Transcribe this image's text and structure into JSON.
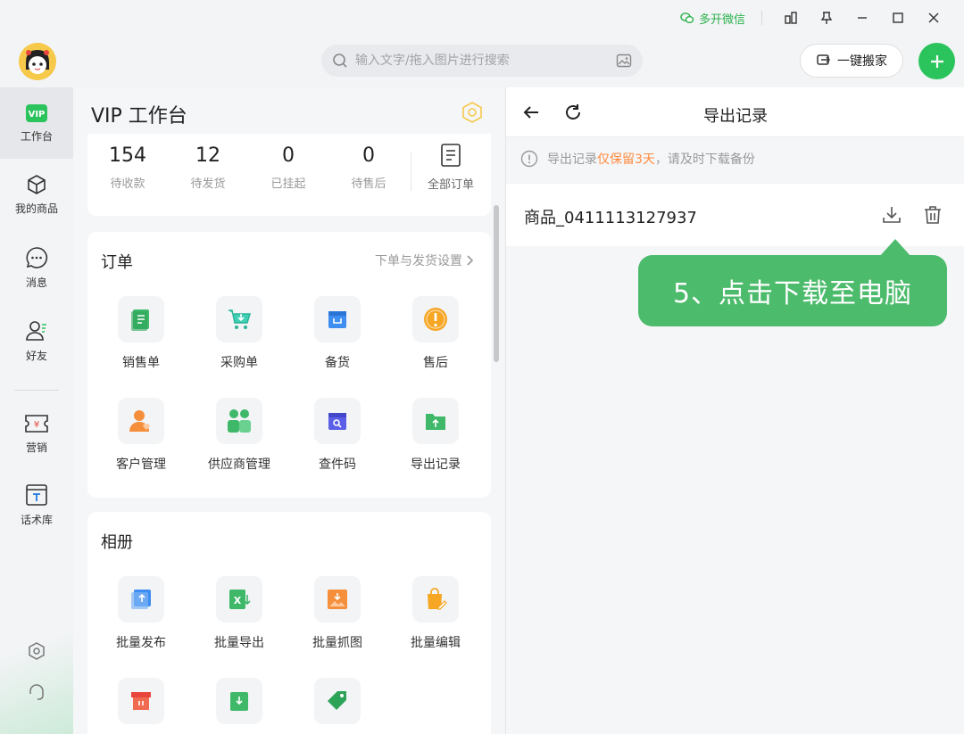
{
  "titlebar": {
    "multi_wechat": "多开微信"
  },
  "header": {
    "search_placeholder": "输入文字/拖入图片进行搜索",
    "move_button": "一键搬家"
  },
  "sidebar": {
    "items": [
      {
        "label": "工作台",
        "icon": "vip-icon"
      },
      {
        "label": "我的商品",
        "icon": "box-icon"
      },
      {
        "label": "消息",
        "icon": "chat-icon"
      },
      {
        "label": "好友",
        "icon": "friend-icon"
      },
      {
        "label": "营销",
        "icon": "coupon-icon"
      },
      {
        "label": "话术库",
        "icon": "script-icon"
      }
    ]
  },
  "main": {
    "title": "VIP 工作台",
    "stats": [
      {
        "num": "154",
        "label": "待收款"
      },
      {
        "num": "12",
        "label": "待发货"
      },
      {
        "num": "0",
        "label": "已挂起"
      },
      {
        "num": "0",
        "label": "待售后"
      }
    ],
    "all_orders": "全部订单",
    "orders_card": {
      "title": "订单",
      "link": "下单与发货设置",
      "items": [
        "销售单",
        "采购单",
        "备货",
        "售后",
        "客户管理",
        "供应商管理",
        "查件码",
        "导出记录"
      ]
    },
    "album_card": {
      "title": "相册",
      "items": [
        "批量发布",
        "批量导出",
        "批量抓图",
        "批量编辑"
      ]
    }
  },
  "right": {
    "title": "导出记录",
    "notice_prefix": "导出记录",
    "notice_highlight": "仅保留3天",
    "notice_suffix": "，请及时下载备份",
    "record_name": "商品_0411113127937",
    "tooltip": "5、点击下载至电脑"
  },
  "colors": {
    "brand_green": "#2bc45c",
    "tooltip_green": "#4cbb6c",
    "highlight_orange": "#ff8a3d"
  }
}
